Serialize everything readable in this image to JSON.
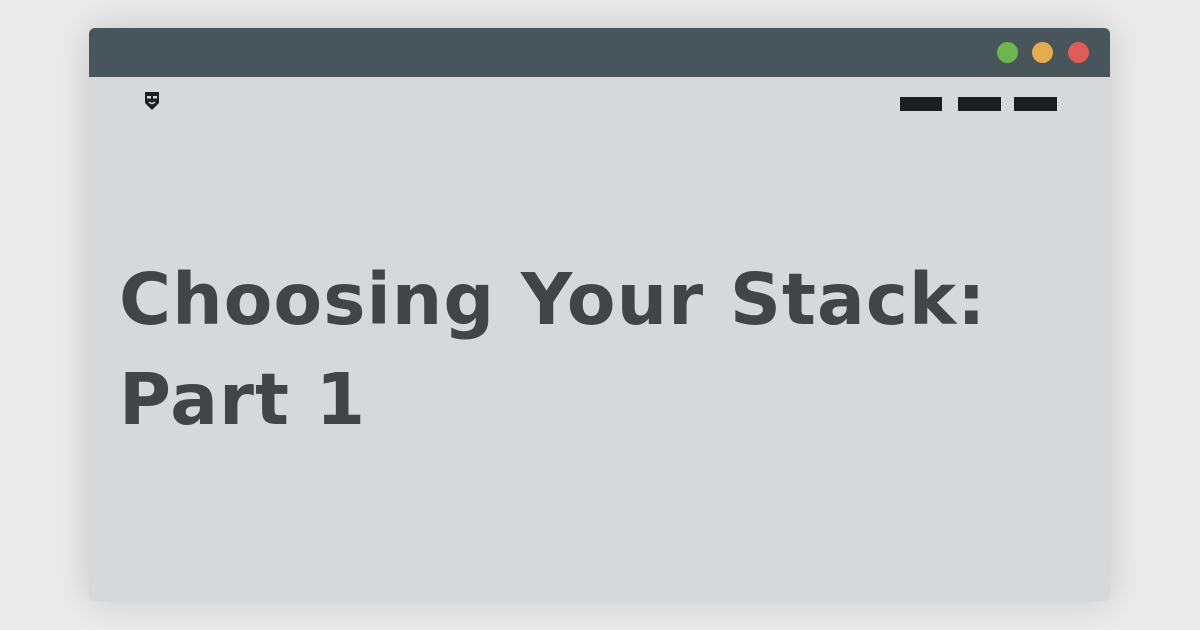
{
  "window": {
    "controls": {
      "green": "#6db64b",
      "yellow": "#e3ad4f",
      "red": "#de5d59"
    }
  },
  "header": {
    "logo_icon": "masked-face-shield-icon",
    "menu_icon": "menu-bars-icon"
  },
  "article": {
    "title_line1": "Choosing Your Stack:",
    "title_line2": "Part 1"
  }
}
